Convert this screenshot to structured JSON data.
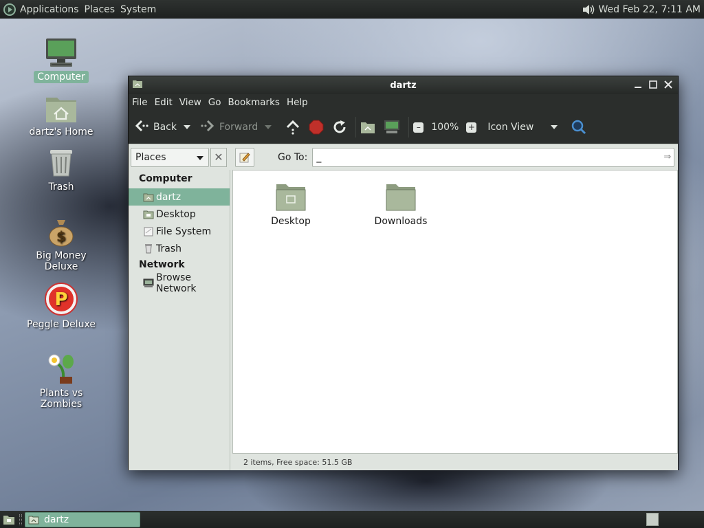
{
  "top_panel": {
    "menus": [
      "Applications",
      "Places",
      "System"
    ],
    "clock": "Wed Feb 22,  7:11 AM",
    "icons": {
      "logo": "distro-logo-icon",
      "volume": "volume-icon"
    }
  },
  "desktop_icons": [
    {
      "label": "Computer",
      "icon": "computer-icon",
      "selected": true
    },
    {
      "label": "dartz's Home",
      "icon": "home-folder-icon"
    },
    {
      "label": "Trash",
      "icon": "trash-icon"
    },
    {
      "label": "Big Money Deluxe",
      "icon": "money-bag-icon"
    },
    {
      "label": "Peggle Deluxe",
      "icon": "peggle-icon"
    },
    {
      "label": "Plants vs Zombies",
      "icon": "plants-vs-zombies-icon"
    }
  ],
  "window": {
    "title": "dartz",
    "menu": [
      "File",
      "Edit",
      "View",
      "Go",
      "Bookmarks",
      "Help"
    ],
    "toolbar": {
      "back": "Back",
      "forward": "Forward",
      "zoom": "100%",
      "view_mode": "Icon View"
    },
    "location": {
      "places_select": "Places",
      "goto_label": "Go To:",
      "goto_value": "_"
    },
    "sidebar": {
      "sections": [
        {
          "title": "Computer",
          "items": [
            {
              "label": "dartz",
              "icon": "home-folder-icon",
              "active": true
            },
            {
              "label": "Desktop",
              "icon": "desktop-folder-icon"
            },
            {
              "label": "File System",
              "icon": "drive-icon"
            },
            {
              "label": "Trash",
              "icon": "trash-icon"
            }
          ]
        },
        {
          "title": "Network",
          "items": [
            {
              "label": "Browse Network",
              "icon": "network-icon"
            }
          ]
        }
      ]
    },
    "files": [
      {
        "label": "Desktop",
        "icon": "desktop-folder-icon"
      },
      {
        "label": "Downloads",
        "icon": "folder-icon"
      }
    ],
    "status": "2 items, Free space: 51.5 GB"
  },
  "bottom_panel": {
    "task_label": "dartz"
  },
  "colors": {
    "selection": "#7fb39b",
    "panel": "#262927",
    "sidebar": "#dfe4df",
    "folder": "#a9b89c"
  }
}
